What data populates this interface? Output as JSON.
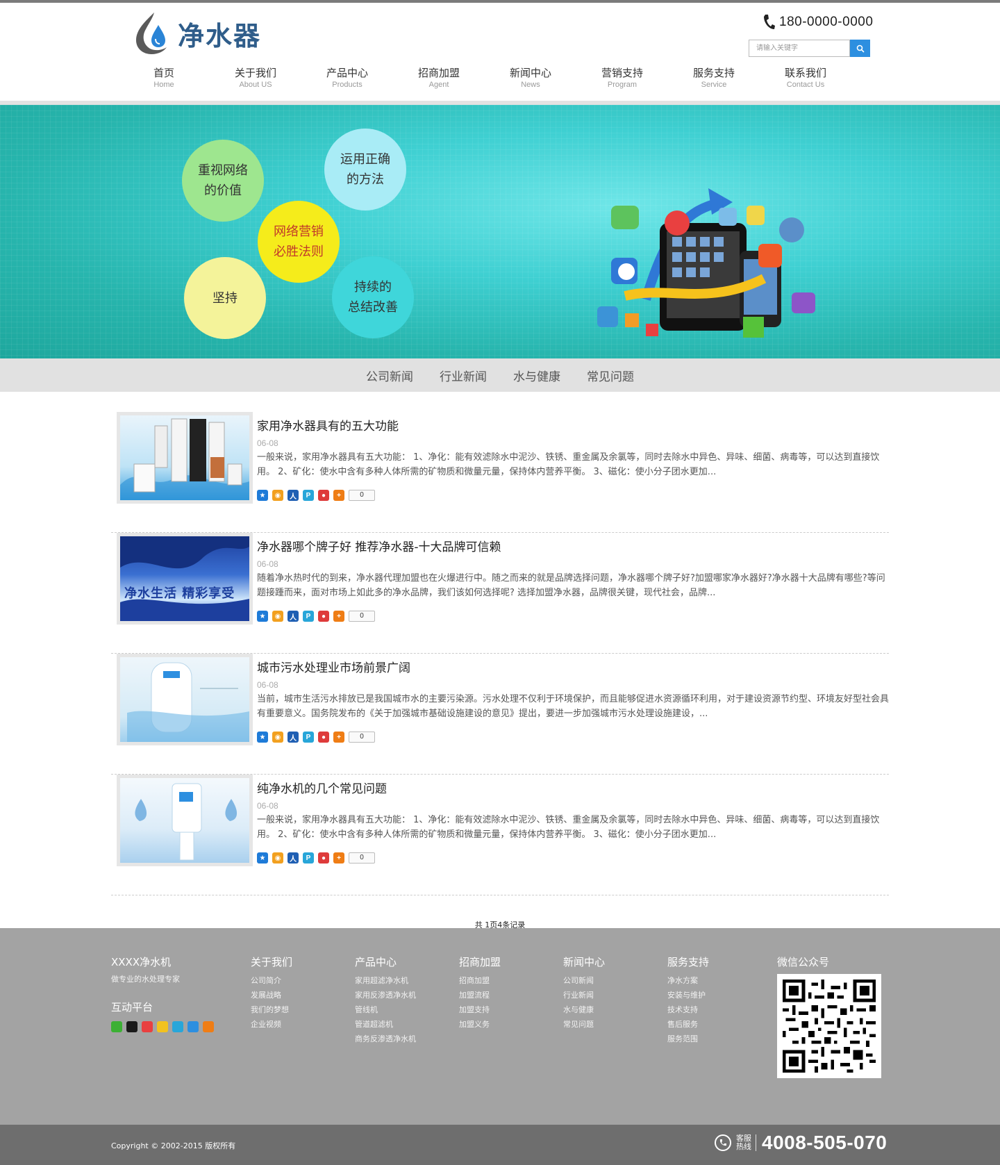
{
  "header": {
    "logo_text": "净水器",
    "phone": "180-0000-0000",
    "search_placeholder": "请输入关键字"
  },
  "nav": [
    {
      "cn": "首页",
      "en": "Home"
    },
    {
      "cn": "关于我们",
      "en": "About US"
    },
    {
      "cn": "产品中心",
      "en": "Products"
    },
    {
      "cn": "招商加盟",
      "en": "Agent"
    },
    {
      "cn": "新闻中心",
      "en": "News"
    },
    {
      "cn": "营销支持",
      "en": "Program"
    },
    {
      "cn": "服务支持",
      "en": "Service"
    },
    {
      "cn": "联系我们",
      "en": "Contact Us"
    }
  ],
  "banner": {
    "bubbles": [
      "重视网络\n的价值",
      "运用正确\n的方法",
      "网络营销\n必胜法则",
      "坚持",
      "持续的\n总结改善"
    ]
  },
  "subnav": [
    "公司新闻",
    "行业新闻",
    "水与健康",
    "常见问题"
  ],
  "articles": [
    {
      "title": "家用净水器具有的五大功能",
      "date": "06-08",
      "desc": "一般来说，家用净水器具有五大功能： 1、净化：能有效滤除水中泥沙、铁锈、重金属及余氯等，同时去除水中异色、异味、细菌、病毒等，可以达到直接饮用。 2、矿化：使水中含有多种人体所需的矿物质和微量元量，保持体内营养平衡。 3、磁化：使小分子团水更加...",
      "count": "0"
    },
    {
      "title": "净水器哪个牌子好 推荐净水器-十大品牌可信赖",
      "date": "06-08",
      "desc": "随着净水热时代的到来，净水器代理加盟也在火爆进行中。随之而来的就是品牌选择问题，净水器哪个牌子好?加盟哪家净水器好?净水器十大品牌有哪些?等问题接踵而来，面对市场上如此多的净水品牌，我们该如何选择呢? 选择加盟净水器，品牌很关键，现代社会，品牌...",
      "count": "0",
      "thumb_text": "净水生活 精彩享受"
    },
    {
      "title": "城市污水处理业市场前景广阔",
      "date": "06-08",
      "desc": "当前，城市生活污水排放已是我国城市水的主要污染源。污水处理不仅利于环境保护，而且能够促进水资源循环利用，对于建设资源节约型、环境友好型社会具有重要意义。国务院发布的《关于加强城市基础设施建设的意见》提出，要进一步加强城市污水处理设施建设，...",
      "count": "0"
    },
    {
      "title": "纯净水机的几个常见问题",
      "date": "06-08",
      "desc": "一般来说，家用净水器具有五大功能： 1、净化：能有效滤除水中泥沙、铁锈、重金属及余氯等，同时去除水中异色、异味、细菌、病毒等，可以达到直接饮用。 2、矿化：使水中含有多种人体所需的矿物质和微量元量，保持体内营养平衡。 3、磁化：使小分子团水更加...",
      "count": "0"
    }
  ],
  "pager": "共 1页4条记录",
  "footer": {
    "brand": "XXXX净水机",
    "brand_sub": "做专业的水处理专家",
    "interact_title": "互动平台",
    "columns": [
      {
        "title": "关于我们",
        "links": [
          "公司简介",
          "发展战略",
          "我们的梦想",
          "企业视频"
        ]
      },
      {
        "title": "产品中心",
        "links": [
          "家用超滤净水机",
          "家用反渗透净水机",
          "管线机",
          "管道超滤机",
          "商务反渗透净水机"
        ]
      },
      {
        "title": "招商加盟",
        "links": [
          "招商加盟",
          "加盟流程",
          "加盟支持",
          "加盟义务"
        ]
      },
      {
        "title": "新闻中心",
        "links": [
          "公司新闻",
          "行业新闻",
          "水与健康",
          "常见问题"
        ]
      },
      {
        "title": "服务支持",
        "links": [
          "净水方案",
          "安装与维护",
          "技术支持",
          "售后服务",
          "服务范围"
        ]
      }
    ],
    "wechat_title": "微信公众号",
    "copyright": "Copyright © 2002-2015 版权所有",
    "hotline_label_1": "客服",
    "hotline_label_2": "热线",
    "hotline": "4008-505-070"
  }
}
